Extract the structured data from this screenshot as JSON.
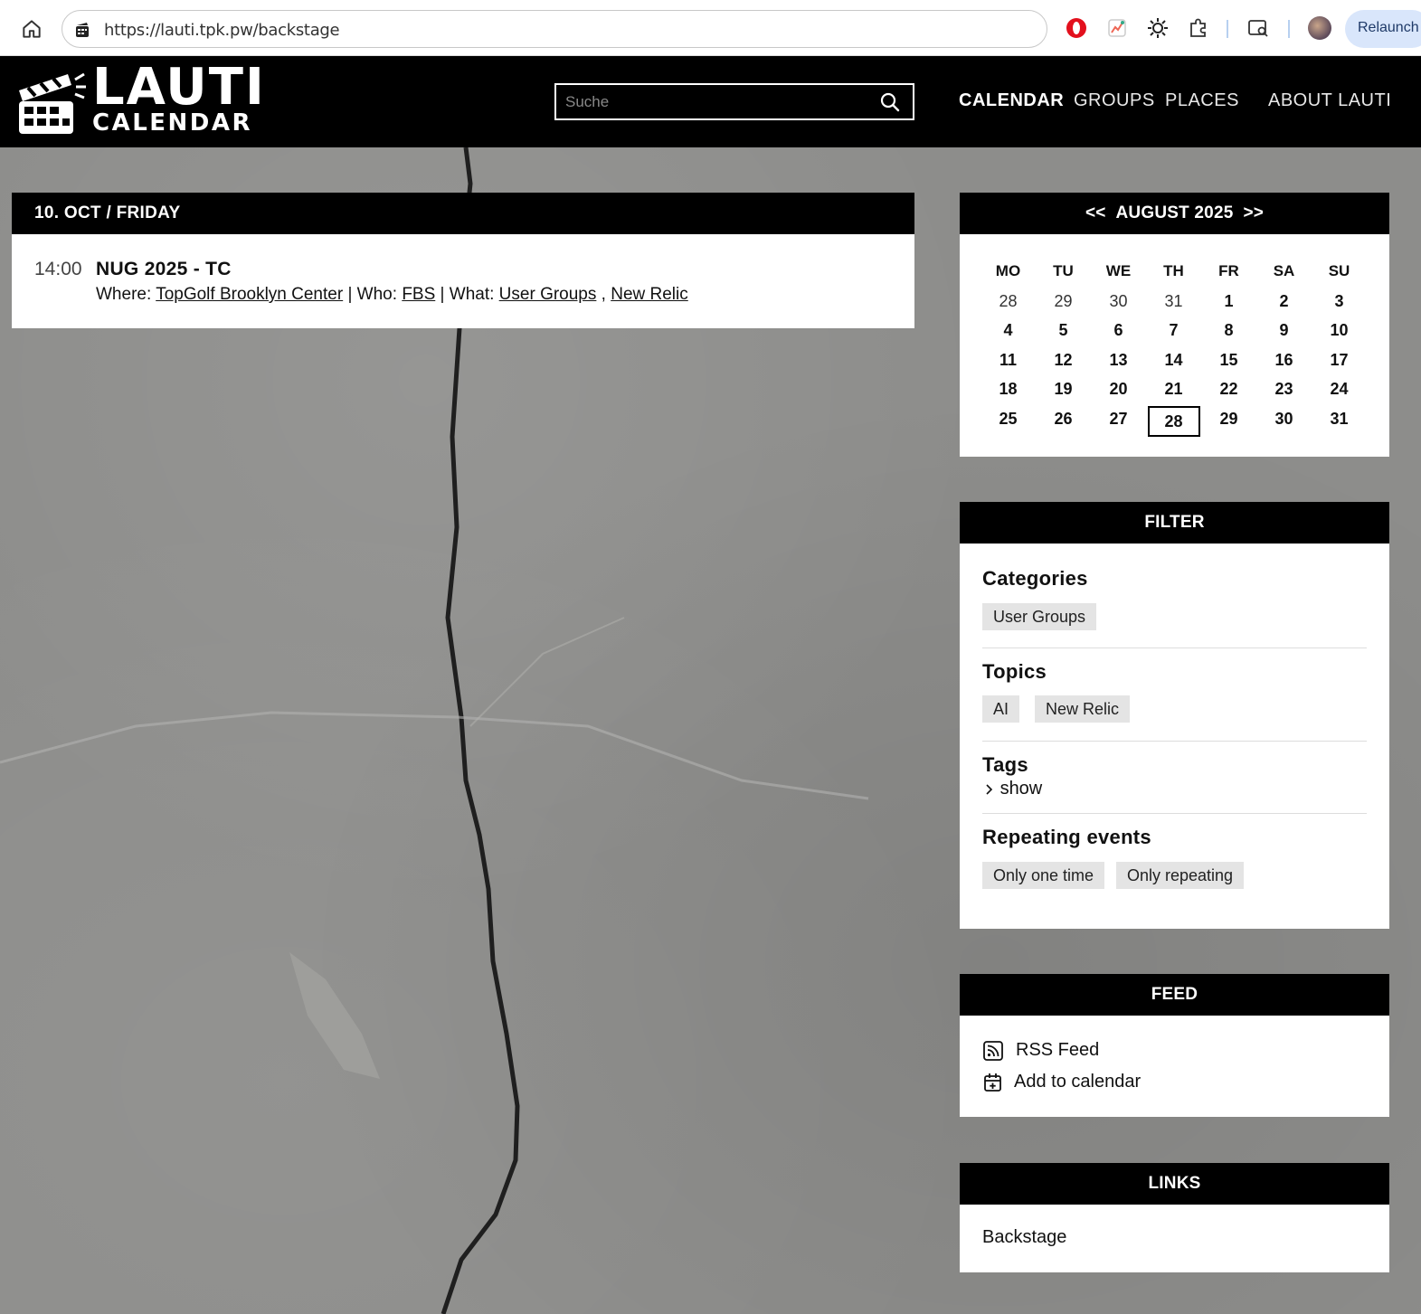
{
  "browser": {
    "url": "https://lauti.tpk.pw/backstage",
    "relaunch_label": "Relaunch"
  },
  "site": {
    "logo_line1": "LAUTI",
    "logo_line2": "CALENDAR",
    "search_placeholder": "Suche",
    "nav": [
      "CALENDAR",
      "GROUPS",
      "PLACES",
      "ABOUT LAUTI"
    ]
  },
  "day": {
    "header": "10. OCT / FRIDAY",
    "events": [
      {
        "time": "14:00",
        "title": "NUG 2025 - TC",
        "where_label": "Where:",
        "where": "TopGolf Brooklyn Center",
        "who_label": "| Who:",
        "who": "FBS",
        "what_label": "| What:",
        "what1": "User Groups",
        "what_sep": ",",
        "what2": "New Relic"
      }
    ]
  },
  "calendar": {
    "prev": "<<",
    "month": "AUGUST 2025",
    "next": ">>",
    "weekdays": [
      "MO",
      "TU",
      "WE",
      "TH",
      "FR",
      "SA",
      "SU"
    ],
    "weeks": [
      [
        "28",
        "29",
        "30",
        "31",
        "1",
        "2",
        "3"
      ],
      [
        "4",
        "5",
        "6",
        "7",
        "8",
        "9",
        "10"
      ],
      [
        "11",
        "12",
        "13",
        "14",
        "15",
        "16",
        "17"
      ],
      [
        "18",
        "19",
        "20",
        "21",
        "22",
        "23",
        "24"
      ],
      [
        "25",
        "26",
        "27",
        "28",
        "29",
        "30",
        "31"
      ]
    ],
    "today": "28"
  },
  "filter": {
    "title": "FILTER",
    "categories_title": "Categories",
    "categories": [
      "User Groups"
    ],
    "topics_title": "Topics",
    "topics": [
      "AI",
      "New Relic"
    ],
    "tags_title": "Tags",
    "tags_toggle": "show",
    "repeat_title": "Repeating events",
    "repeat_options": [
      "Only one time",
      "Only repeating"
    ]
  },
  "feed": {
    "title": "FEED",
    "rss": "RSS Feed",
    "add_calendar": "Add to calendar"
  },
  "links": {
    "title": "LINKS",
    "items": [
      "Backstage"
    ]
  }
}
